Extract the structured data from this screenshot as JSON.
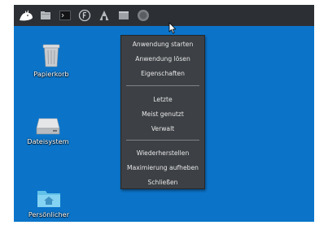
{
  "desktop": {
    "background_color": "#0b74c9",
    "icons": [
      {
        "label": "Papierkorb",
        "icon": "trash-icon"
      },
      {
        "label": "Dateisystem",
        "icon": "drive-icon"
      },
      {
        "label": "Persönlicher",
        "icon": "home-folder-icon"
      }
    ]
  },
  "panel": {
    "background_color": "#2c3034",
    "buttons": [
      {
        "icon": "xfce-menu-icon"
      },
      {
        "icon": "show-desktop-icon"
      },
      {
        "icon": "terminal-icon"
      },
      {
        "icon": "firefox-icon"
      },
      {
        "icon": "app-launcher-icon"
      },
      {
        "icon": "window-icon"
      },
      {
        "icon": "power-icon"
      }
    ]
  },
  "context_menu": {
    "background_color": "#3d4044",
    "groups": [
      {
        "items": [
          "Anwendung starten",
          "Anwendung lösen",
          "Eigenschaften"
        ]
      },
      {
        "items": [
          "Letzte",
          "Meist genutzt",
          "Verwalt"
        ]
      },
      {
        "items": [
          "Wiederherstellen",
          "Maximierung aufheben",
          "Schließen"
        ]
      }
    ]
  }
}
